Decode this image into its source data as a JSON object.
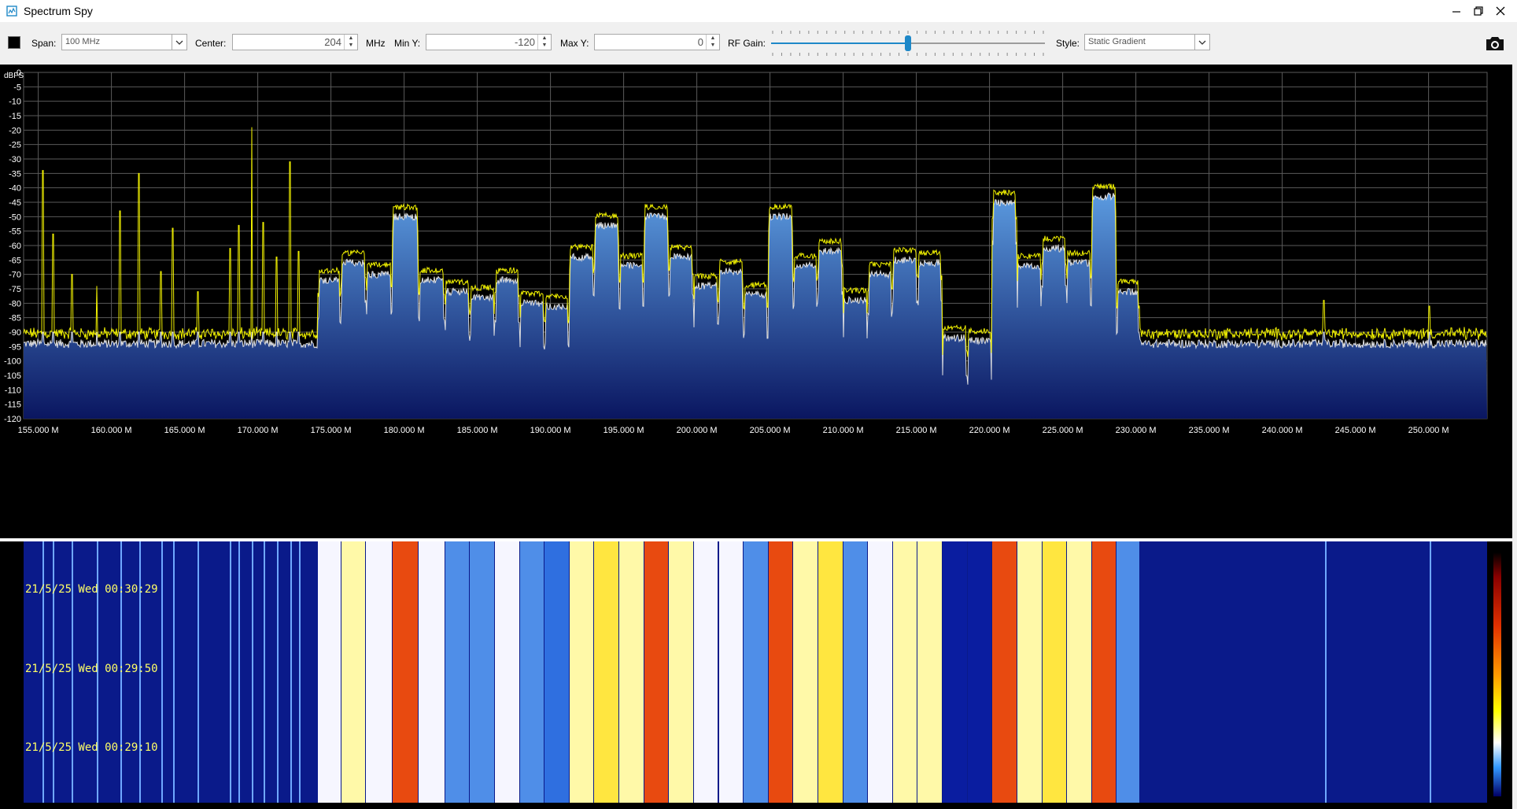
{
  "window": {
    "title": "Spectrum Spy"
  },
  "toolbar": {
    "span_label": "Span:",
    "span_value": "100 MHz",
    "center_label": "Center:",
    "center_value": "204",
    "center_unit": "MHz",
    "miny_label": "Min Y:",
    "miny_value": "-120",
    "maxy_label": "Max Y:",
    "maxy_value": "0",
    "rfgain_label": "RF Gain:",
    "rfgain_level": 0.5,
    "style_label": "Style:",
    "style_value": "Static Gradient"
  },
  "colors": {
    "trace_peak": "#f2f200",
    "trace_avg": "#e0e0e0",
    "fill_top": "#5b9be0",
    "fill_bottom": "#0a1660",
    "grid": "#5a5a5a",
    "accent": "#1e88c8"
  },
  "chart_data": {
    "type": "line",
    "ylabel": "dBFS",
    "ylim": [
      -120,
      0
    ],
    "xlim": [
      154.0,
      254.0
    ],
    "yticks": [
      "0",
      "-5",
      "-10",
      "-15",
      "-20",
      "-25",
      "-30",
      "-35",
      "-40",
      "-45",
      "-50",
      "-55",
      "-60",
      "-65",
      "-70",
      "-75",
      "-80",
      "-85",
      "-90",
      "-95",
      "-100",
      "-105",
      "-110",
      "-115",
      "-120"
    ],
    "xticks": [
      "155.000 M",
      "160.000 M",
      "165.000 M",
      "170.000 M",
      "175.000 M",
      "180.000 M",
      "185.000 M",
      "190.000 M",
      "195.000 M",
      "200.000 M",
      "205.000 M",
      "210.000 M",
      "215.000 M",
      "220.000 M",
      "225.000 M",
      "230.000 M",
      "235.000 M",
      "240.000 M",
      "245.000 M",
      "250.000 M"
    ],
    "grid": true,
    "noise_floor": -92,
    "channels": [
      {
        "start": 174.1,
        "end": 175.7,
        "level": -69
      },
      {
        "start": 175.7,
        "end": 177.4,
        "level": -63
      },
      {
        "start": 177.4,
        "end": 179.2,
        "level": -67
      },
      {
        "start": 179.2,
        "end": 181.0,
        "level": -47
      },
      {
        "start": 181.0,
        "end": 182.8,
        "level": -69
      },
      {
        "start": 182.8,
        "end": 184.5,
        "level": -73
      },
      {
        "start": 184.5,
        "end": 186.2,
        "level": -75
      },
      {
        "start": 186.2,
        "end": 187.9,
        "level": -69
      },
      {
        "start": 187.9,
        "end": 189.6,
        "level": -77
      },
      {
        "start": 189.6,
        "end": 191.3,
        "level": -78
      },
      {
        "start": 191.3,
        "end": 193.0,
        "level": -61
      },
      {
        "start": 193.0,
        "end": 194.7,
        "level": -50
      },
      {
        "start": 194.7,
        "end": 196.4,
        "level": -64
      },
      {
        "start": 196.4,
        "end": 198.1,
        "level": -47
      },
      {
        "start": 198.1,
        "end": 199.8,
        "level": -61
      },
      {
        "start": 199.8,
        "end": 201.5,
        "level": -71
      },
      {
        "start": 201.5,
        "end": 203.2,
        "level": -66
      },
      {
        "start": 203.2,
        "end": 204.9,
        "level": -74
      },
      {
        "start": 204.9,
        "end": 206.6,
        "level": -47
      },
      {
        "start": 206.6,
        "end": 208.3,
        "level": -64
      },
      {
        "start": 208.3,
        "end": 210.0,
        "level": -59
      },
      {
        "start": 210.0,
        "end": 211.7,
        "level": -76
      },
      {
        "start": 211.7,
        "end": 213.4,
        "level": -67
      },
      {
        "start": 213.4,
        "end": 215.1,
        "level": -62
      },
      {
        "start": 215.1,
        "end": 216.8,
        "level": -63
      },
      {
        "start": 216.8,
        "end": 218.5,
        "level": -89
      },
      {
        "start": 218.5,
        "end": 220.2,
        "level": -90
      },
      {
        "start": 220.2,
        "end": 221.9,
        "level": -42
      },
      {
        "start": 221.9,
        "end": 223.6,
        "level": -64
      },
      {
        "start": 223.6,
        "end": 225.3,
        "level": -58
      },
      {
        "start": 225.3,
        "end": 227.0,
        "level": -63
      },
      {
        "start": 227.0,
        "end": 228.7,
        "level": -40
      },
      {
        "start": 228.7,
        "end": 230.3,
        "level": -73
      }
    ],
    "spikes": [
      {
        "freq": 155.3,
        "level": -34
      },
      {
        "freq": 156.0,
        "level": -56
      },
      {
        "freq": 157.3,
        "level": -70
      },
      {
        "freq": 159.0,
        "level": -74
      },
      {
        "freq": 160.6,
        "level": -48
      },
      {
        "freq": 161.9,
        "level": -35
      },
      {
        "freq": 163.4,
        "level": -69
      },
      {
        "freq": 164.2,
        "level": -54
      },
      {
        "freq": 165.9,
        "level": -76
      },
      {
        "freq": 168.1,
        "level": -61
      },
      {
        "freq": 168.7,
        "level": -53
      },
      {
        "freq": 169.6,
        "level": -19
      },
      {
        "freq": 170.4,
        "level": -52
      },
      {
        "freq": 171.3,
        "level": -64
      },
      {
        "freq": 172.2,
        "level": -31
      },
      {
        "freq": 172.8,
        "level": -62
      },
      {
        "freq": 242.9,
        "level": -79
      },
      {
        "freq": 250.1,
        "level": -81
      }
    ]
  },
  "waterfall": {
    "timestamps": [
      "21/5/25 Wed 00:30:29",
      "21/5/25 Wed 00:29:50",
      "21/5/25 Wed 00:29:10"
    ]
  }
}
